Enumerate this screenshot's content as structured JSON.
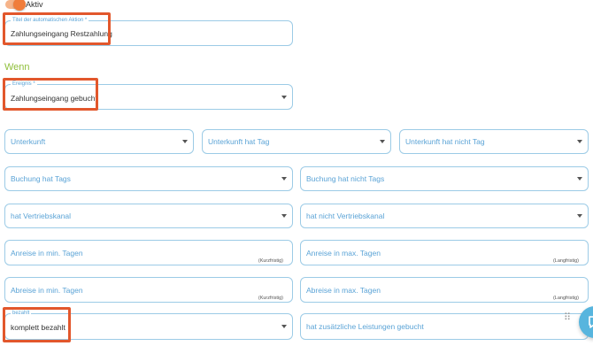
{
  "toggle": {
    "label": "Aktiv",
    "on": true
  },
  "title_field": {
    "legend": "Titel der automatischen Aktion *",
    "value": "Zahlungseingang Restzahlung"
  },
  "section": {
    "heading": "Wenn"
  },
  "event_field": {
    "legend": "Ereignis *",
    "value": "Zahlungseingang gebucht"
  },
  "filters": {
    "unterkunft": "Unterkunft",
    "unterkunft_hat_tag": "Unterkunft hat Tag",
    "unterkunft_hat_nicht_tag": "Unterkunft hat nicht Tag",
    "buchung_hat_tags": "Buchung hat Tags",
    "buchung_hat_nicht_tags": "Buchung hat nicht Tags",
    "hat_vertriebskanal": "hat Vertriebskanal",
    "hat_nicht_vertriebskanal": "hat nicht Vertriebskanal",
    "anreise_min": {
      "placeholder": "Anreise in min. Tagen",
      "hint": "(Kurzfristig)"
    },
    "anreise_max": {
      "placeholder": "Anreise in max. Tagen",
      "hint": "(Langfristig)"
    },
    "abreise_min": {
      "placeholder": "Abreise in min. Tagen",
      "hint": "(Kurzfristig)"
    },
    "abreise_max": {
      "placeholder": "Abreise in max. Tagen",
      "hint": "(Langfristig)"
    }
  },
  "paid_field": {
    "legend": "bezahlt",
    "value": "komplett bezahlt"
  },
  "extras_field": {
    "placeholder": "hat zusätzliche Leistungen gebucht"
  },
  "colors": {
    "accent_orange": "#f07d3b",
    "highlight": "#e2572c",
    "field_blue": "#5aa3d6",
    "heading_green": "#8fbf3a",
    "chat_blue": "#57b5de"
  },
  "icons": {
    "caret": "chevron-down-icon",
    "drag": "drag-handle-icon",
    "chat": "chat-icon"
  }
}
